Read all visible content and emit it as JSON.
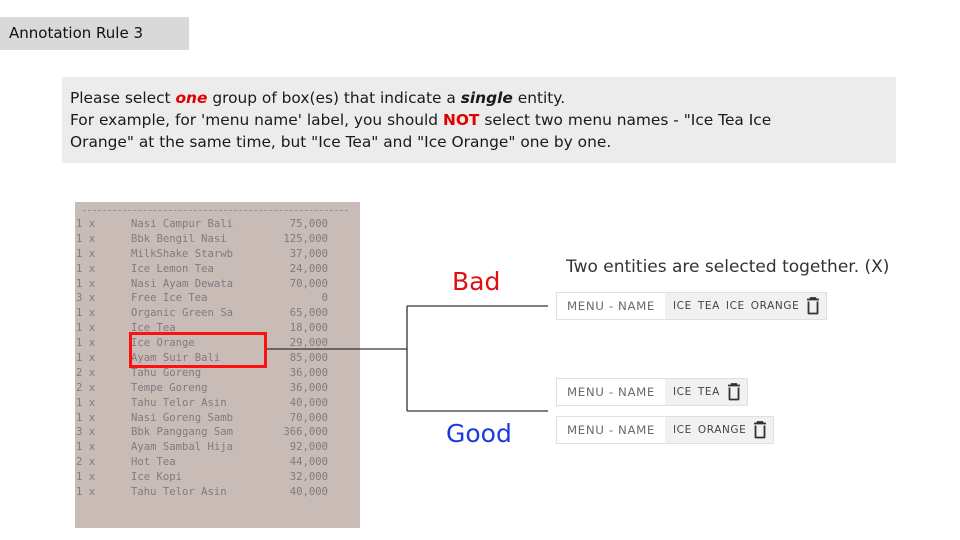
{
  "slide_tag": "Annotation Rule 3",
  "rule": {
    "line1": {
      "a": "Please select ",
      "b": "one",
      "c": " group of box(es) that indicate a ",
      "d": "single",
      "e": " entity."
    },
    "line2": {
      "a": "For example, for 'menu name' label, you should ",
      "b": "NOT",
      "c": " select two menu names - \"Ice Tea Ice"
    },
    "line3": "Orange\" at the same time, but \"Ice Tea\" and \"Ice Orange\" one by one."
  },
  "receipt_rows": [
    {
      "q": "1 x",
      "n": "Nasi Campur Bali",
      "p": "75,000"
    },
    {
      "q": "1 x",
      "n": "Bbk Bengil Nasi",
      "p": "125,000"
    },
    {
      "q": "1 x",
      "n": "MilkShake Starwb",
      "p": "37,000"
    },
    {
      "q": "1 x",
      "n": "Ice Lemon Tea",
      "p": "24,000"
    },
    {
      "q": "1 x",
      "n": "Nasi Ayam Dewata",
      "p": "70,000"
    },
    {
      "q": "3 x",
      "n": "Free Ice Tea",
      "p": "0"
    },
    {
      "q": "1 x",
      "n": "Organic Green Sa",
      "p": "65,000"
    },
    {
      "q": "1 x",
      "n": "Ice Tea",
      "p": "18,000"
    },
    {
      "q": "1 x",
      "n": "Ice Orange",
      "p": "29,000"
    },
    {
      "q": "1 x",
      "n": "Ayam Suir Bali",
      "p": "85,000"
    },
    {
      "q": "2 x",
      "n": "Tahu Goreng",
      "p": "36,000"
    },
    {
      "q": "2 x",
      "n": "Tempe Goreng",
      "p": "36,000"
    },
    {
      "q": "1 x",
      "n": "Tahu Telor Asin",
      "p": "40,000"
    },
    {
      "q": "1 x",
      "n": "Nasi Goreng Samb",
      "p": "70,000"
    },
    {
      "q": "3 x",
      "n": "Bbk Panggang Sam",
      "p": "366,000"
    },
    {
      "q": "1 x",
      "n": "Ayam Sambal Hija",
      "p": "92,000"
    },
    {
      "q": "2 x",
      "n": "Hot Tea",
      "p": "44,000"
    },
    {
      "q": "1 x",
      "n": "Ice Kopi",
      "p": "32,000"
    },
    {
      "q": "1 x",
      "n": "Tahu Telor Asin",
      "p": "40,000"
    }
  ],
  "bad_label": "Bad",
  "good_label": "Good",
  "bad_note": "Two entities are selected together. (X)",
  "chips": {
    "label": "MENU - NAME",
    "bad_tokens": [
      "ICE",
      "TEA",
      "ICE",
      "ORANGE"
    ],
    "good1_tokens": [
      "ICE",
      "TEA"
    ],
    "good2_tokens": [
      "ICE",
      "ORANGE"
    ]
  },
  "colors": {
    "bad": "#e01010",
    "good": "#1c3bdc",
    "highlight": "#ff1010",
    "emphasis": "#e00000"
  }
}
